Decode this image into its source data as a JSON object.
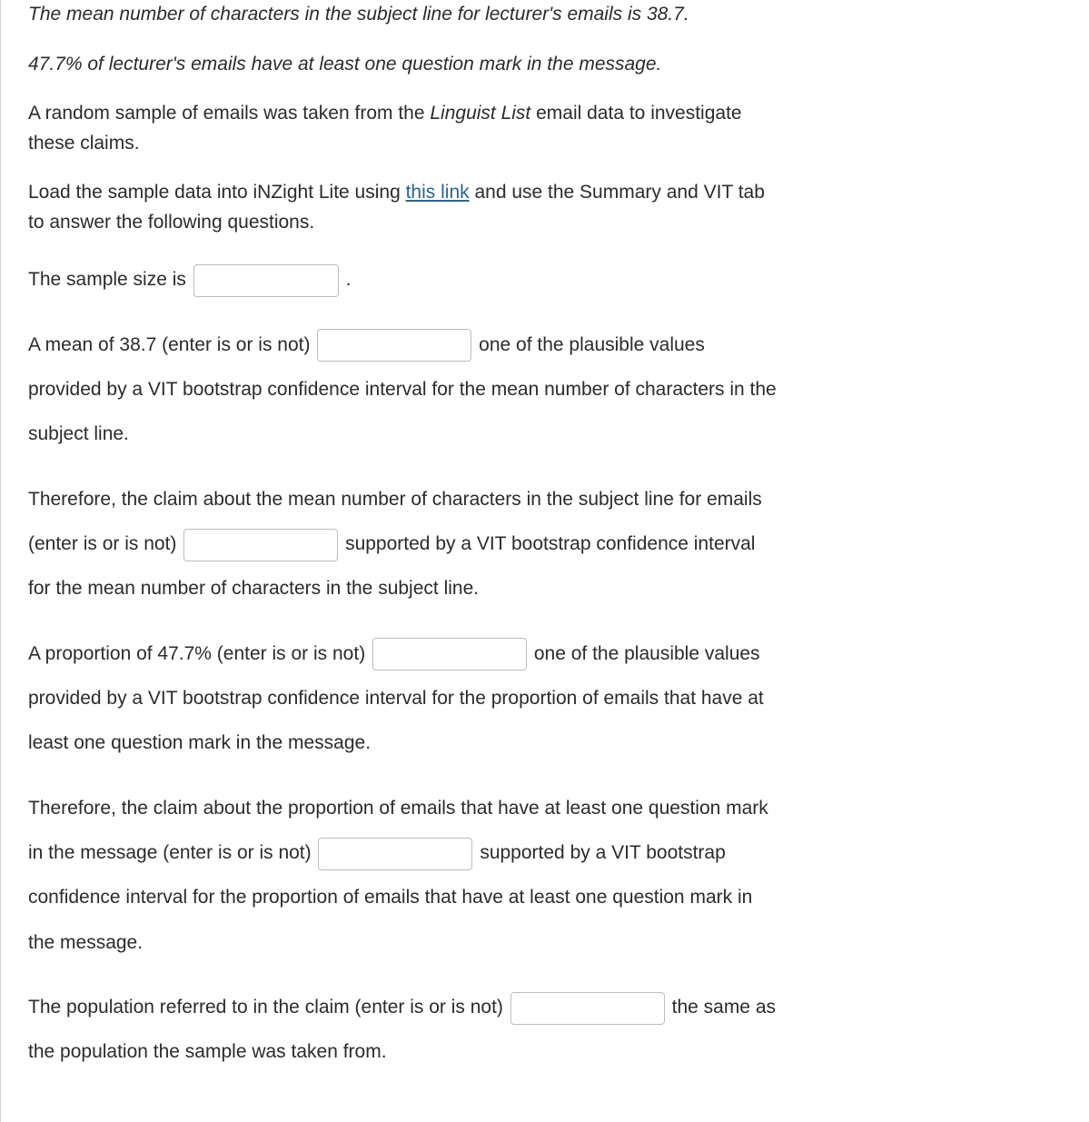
{
  "claims": {
    "line1": "The mean number of characters in the subject line for lecturer's emails is 38.7.",
    "line2": "47.7% of lecturer's emails have at least one question mark in the message."
  },
  "sample": {
    "intro_a": "A random sample of emails was taken from the ",
    "intro_b_italic": "Linguist List",
    "intro_c": " email data to investigate these claims."
  },
  "load": {
    "pre": "Load the sample data into iNZight Lite using ",
    "link": "this link",
    "post": " and use the Summary and VIT tab to answer the following questions."
  },
  "q1": {
    "pre": "The sample size is ",
    "post": " ."
  },
  "q2": {
    "pre": "A mean of 38.7 (enter is or is not) ",
    "post": " one of the plausible values provided by a VIT bootstrap confidence interval for the mean number of characters in the subject line."
  },
  "q3": {
    "pre": "Therefore, the claim about the mean number of characters in the subject line for emails (enter is or is not) ",
    "post": " supported by a VIT bootstrap confidence interval for the mean number of characters in the subject line."
  },
  "q4": {
    "pre": "A proportion of 47.7% (enter is or is not) ",
    "post": " one of the plausible values provided by a VIT bootstrap confidence interval for the proportion of emails that have at least one question mark in the message."
  },
  "q5": {
    "pre": "Therefore, the claim about the proportion of emails that have at least one question mark in the message (enter is or is not) ",
    "post": " supported by a VIT bootstrap confidence interval for the proportion of emails that have at least one question mark in the message."
  },
  "q6": {
    "pre": "The population referred to in the claim (enter is or is not) ",
    "post": " the same as the population the sample was taken from."
  }
}
